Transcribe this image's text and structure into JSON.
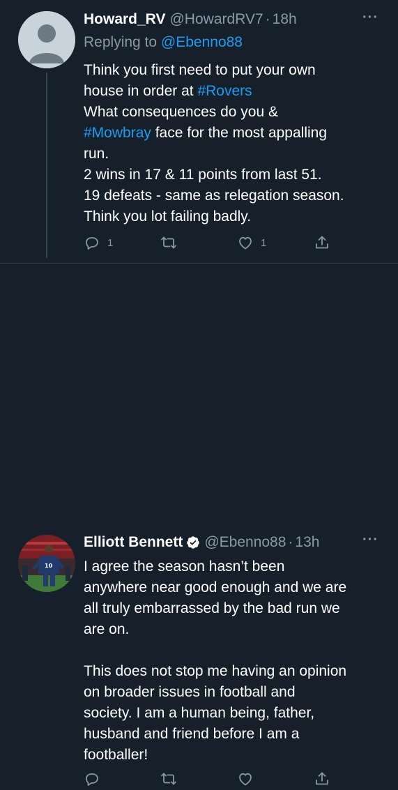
{
  "tweets": [
    {
      "display_name": "Howard_RV",
      "handle": "@HowardRV7",
      "separator": "·",
      "time": "18h",
      "more": "···",
      "replying_prefix": "Replying to ",
      "replying_to": "@Ebenno88",
      "body": {
        "l1": "Think you first need to put your own",
        "l2_text": "house in order at ",
        "l2_tag": "#Rovers",
        "l3": "What consequences do you &",
        "l4_tag": "#Mowbray",
        "l4_text": " face for the most appalling",
        "l5": "run.",
        "l6": "2 wins in 17 & 11 points from last 51.",
        "l7": "19 defeats - same as relegation season.",
        "l8": "Think you lot failing badly."
      },
      "actions": {
        "reply_count": "1",
        "retweet_count": "",
        "like_count": "1"
      }
    },
    {
      "display_name": "Elliott Bennett",
      "verified": true,
      "handle": "@Ebenno88",
      "separator": "·",
      "time": "13h",
      "more": "···",
      "body": {
        "l1": "I agree the season hasn’t been",
        "l2": "anywhere near good enough and we are",
        "l3": "all truly embarrassed by the bad run we",
        "l4": "are on.",
        "l5": "This does not stop me having an opinion",
        "l6": "on broader issues in football and",
        "l7": "society. I am a human being, father,",
        "l8": "husband and friend before I am a",
        "l9": "footballer!"
      },
      "actions": {
        "reply_count": "",
        "retweet_count": "",
        "like_count": ""
      }
    }
  ],
  "colors": {
    "background": "#15202b",
    "text": "#ffffff",
    "muted": "#8b98a5",
    "link": "#1d9bf0",
    "divider": "#38444d"
  },
  "icons": [
    "default-avatar-icon",
    "verified-icon",
    "more-icon",
    "reply-icon",
    "retweet-icon",
    "like-icon",
    "share-icon"
  ]
}
